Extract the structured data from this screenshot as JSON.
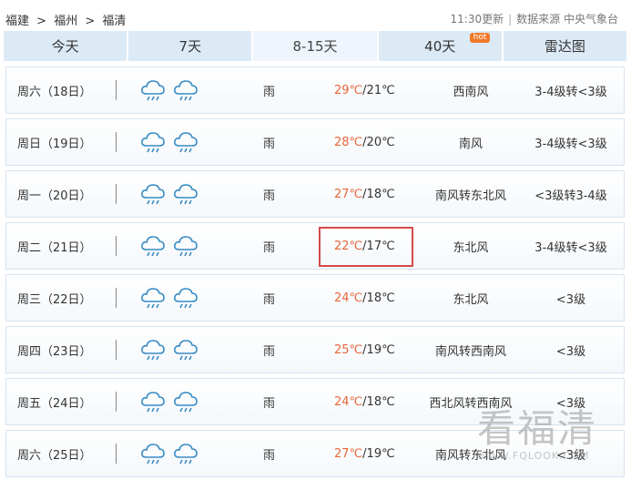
{
  "breadcrumb": [
    "福建",
    ">",
    "福州",
    ">",
    "福清"
  ],
  "meta": {
    "updated": "11:30更新",
    "source": "数据来源 中央气象台"
  },
  "tabs": [
    {
      "label": "今天"
    },
    {
      "label": "7天"
    },
    {
      "label": "8-15天",
      "active": true
    },
    {
      "label": "40天",
      "badge": "hot"
    },
    {
      "label": "雷达图"
    }
  ],
  "days": [
    {
      "day": "周六（18日）",
      "weather": "雨",
      "high": "29℃",
      "low": "21℃",
      "wind_dir": "西南风",
      "wind_level": "3-4级转<3级"
    },
    {
      "day": "周日（19日）",
      "weather": "雨",
      "high": "28℃",
      "low": "20℃",
      "wind_dir": "南风",
      "wind_level": "3-4级转<3级"
    },
    {
      "day": "周一（20日）",
      "weather": "雨",
      "high": "27℃",
      "low": "18℃",
      "wind_dir": "南风转东北风",
      "wind_level": "<3级转3-4级"
    },
    {
      "day": "周二（21日）",
      "weather": "雨",
      "high": "22℃",
      "low": "17℃",
      "wind_dir": "东北风",
      "wind_level": "3-4级转<3级"
    },
    {
      "day": "周三（22日）",
      "weather": "雨",
      "high": "24℃",
      "low": "18℃",
      "wind_dir": "东北风",
      "wind_level": "<3级"
    },
    {
      "day": "周四（23日）",
      "weather": "雨",
      "high": "25℃",
      "low": "19℃",
      "wind_dir": "南风转西南风",
      "wind_level": "<3级"
    },
    {
      "day": "周五（24日）",
      "weather": "雨",
      "high": "24℃",
      "low": "18℃",
      "wind_dir": "西北风转西南风",
      "wind_level": "<3级"
    },
    {
      "day": "周六（25日）",
      "weather": "雨",
      "high": "27℃",
      "low": "19℃",
      "wind_dir": "南风转东北风",
      "wind_level": "<3级"
    }
  ],
  "weather_icons": [
    "rain-cloud-icon",
    "rain-cloud-icon"
  ],
  "watermark": {
    "main": "看福清",
    "sub": "WWW.FQLOOK.COM"
  },
  "colors": {
    "tab_bg": "#dceaf6",
    "high_temp": "#e8663a",
    "highlight_border": "#d44a4a",
    "badge": "#f07a2a"
  }
}
